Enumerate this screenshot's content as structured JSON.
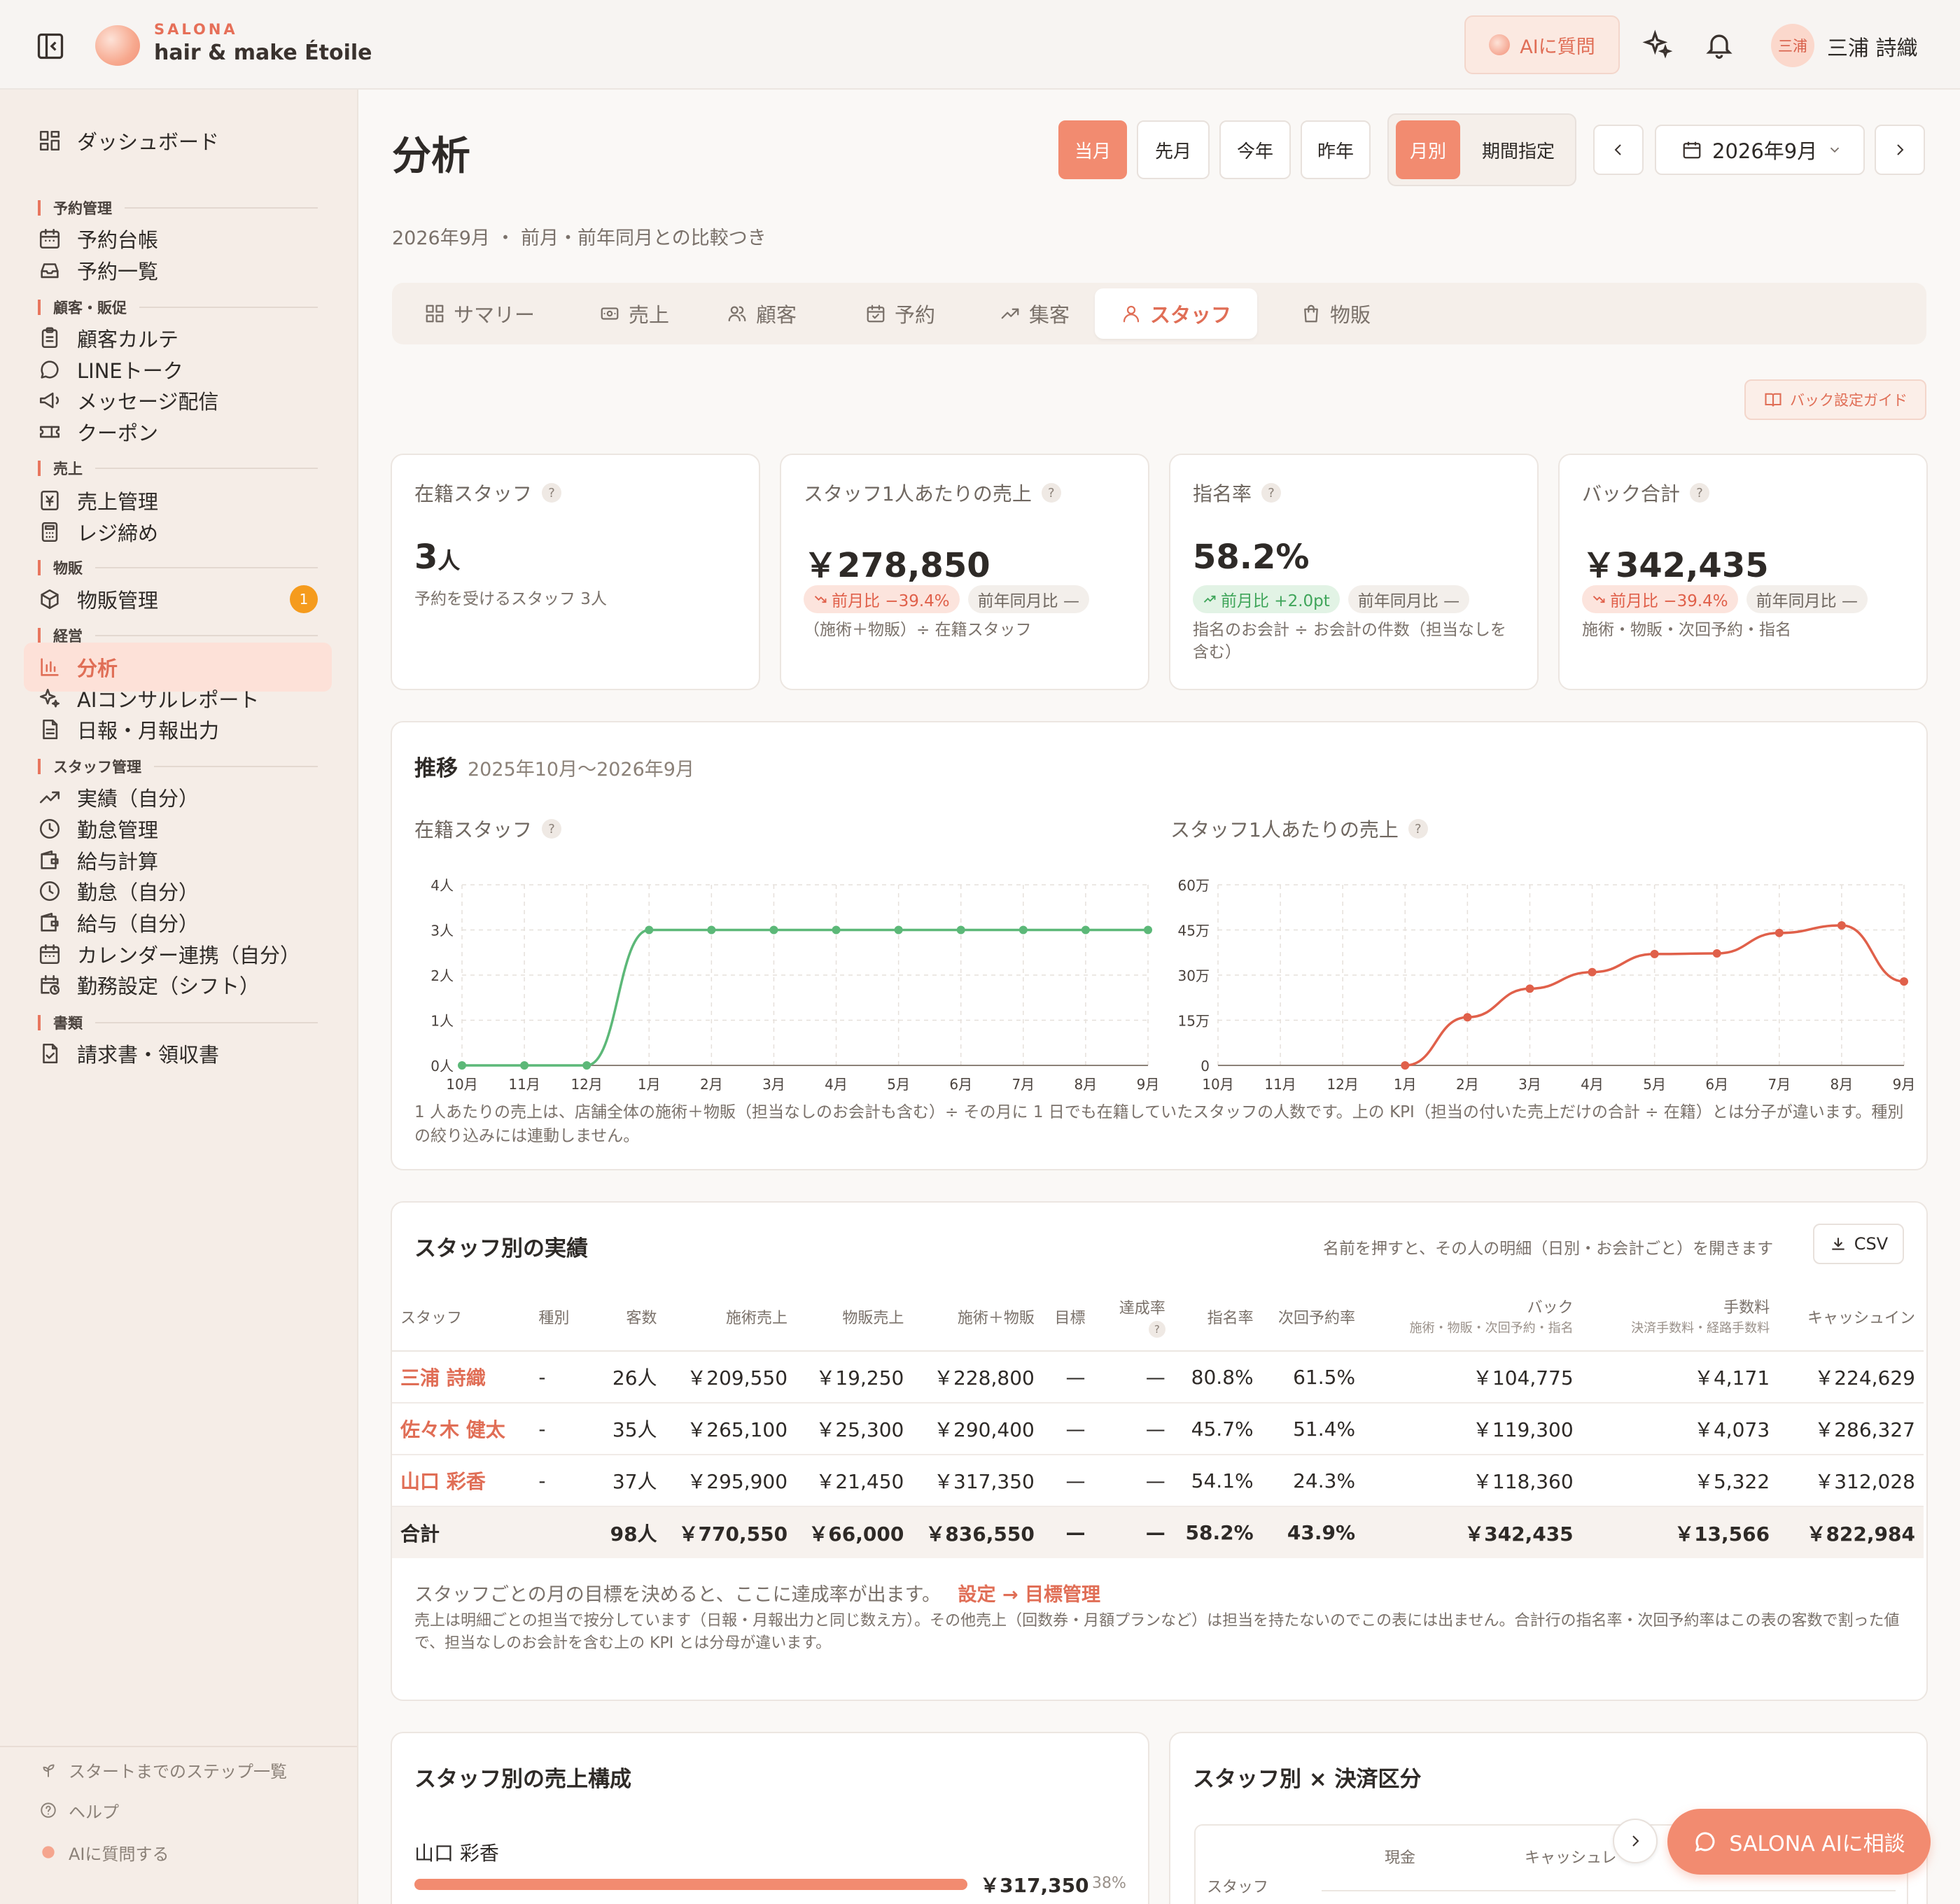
{
  "header": {
    "brand_small": "SALONA",
    "brand_name": "hair & make Étoile",
    "ai_button": "AIに質問",
    "avatar_text": "三浦",
    "user_name": "三浦 詩織"
  },
  "sidebar": {
    "items": [
      {
        "type": "item",
        "label": "ダッシュボード",
        "icon": "dashboard-icon"
      },
      {
        "type": "section",
        "label": "予約管理"
      },
      {
        "type": "item",
        "label": "予約台帳",
        "icon": "calendar-icon"
      },
      {
        "type": "item",
        "label": "予約一覧",
        "icon": "inbox-icon"
      },
      {
        "type": "section",
        "label": "顧客・販促"
      },
      {
        "type": "item",
        "label": "顧客カルテ",
        "icon": "clipboard-icon"
      },
      {
        "type": "item",
        "label": "LINEトーク",
        "icon": "chat-icon"
      },
      {
        "type": "item",
        "label": "メッセージ配信",
        "icon": "megaphone-icon"
      },
      {
        "type": "item",
        "label": "クーポン",
        "icon": "ticket-icon"
      },
      {
        "type": "section",
        "label": "売上"
      },
      {
        "type": "item",
        "label": "売上管理",
        "icon": "yen-receipt-icon"
      },
      {
        "type": "item",
        "label": "レジ締め",
        "icon": "calculator-icon"
      },
      {
        "type": "section",
        "label": "物販"
      },
      {
        "type": "item",
        "label": "物販管理",
        "icon": "box-icon",
        "badge": "1"
      },
      {
        "type": "section",
        "label": "経営"
      },
      {
        "type": "item",
        "label": "分析",
        "icon": "bar-chart-icon",
        "active": true
      },
      {
        "type": "item",
        "label": "AIコンサルレポート",
        "icon": "sparkles-icon"
      },
      {
        "type": "item",
        "label": "日報・月報出力",
        "icon": "document-icon"
      },
      {
        "type": "section",
        "label": "スタッフ管理"
      },
      {
        "type": "item",
        "label": "実績（自分）",
        "icon": "trending-up-icon"
      },
      {
        "type": "item",
        "label": "勤怠管理",
        "icon": "clock-icon"
      },
      {
        "type": "item",
        "label": "給与計算",
        "icon": "wallet-icon"
      },
      {
        "type": "item",
        "label": "勤怠（自分）",
        "icon": "clock-icon"
      },
      {
        "type": "item",
        "label": "給与（自分）",
        "icon": "wallet-icon"
      },
      {
        "type": "item",
        "label": "カレンダー連携（自分）",
        "icon": "calendar-icon"
      },
      {
        "type": "item",
        "label": "勤務設定（シフト）",
        "icon": "calendar-clock-icon"
      },
      {
        "type": "section",
        "label": "書類"
      },
      {
        "type": "item",
        "label": "請求書・領収書",
        "icon": "document-check-icon"
      }
    ],
    "footer": [
      {
        "label": "スタートまでのステップ一覧",
        "icon": "sprout-icon"
      },
      {
        "label": "ヘルプ",
        "icon": "help-icon"
      },
      {
        "label": "AIに質問する",
        "icon": "ai-dot-icon"
      }
    ]
  },
  "page": {
    "title": "分析",
    "subtitle": "2026年9月 ・ 前月・前年同月との比較つき",
    "period_buttons": [
      "当月",
      "先月",
      "今年",
      "昨年"
    ],
    "active_period": "当月",
    "view_modes": [
      "月別",
      "期間指定"
    ],
    "active_view": "月別",
    "current_month": "2026年9月",
    "guide_button": "バック設定ガイド"
  },
  "tabs": [
    {
      "label": "サマリー",
      "icon": "grid-icon"
    },
    {
      "label": "売上",
      "icon": "cash-icon"
    },
    {
      "label": "顧客",
      "icon": "users-icon"
    },
    {
      "label": "予約",
      "icon": "calendar-check-icon"
    },
    {
      "label": "集客",
      "icon": "trending-up-icon"
    },
    {
      "label": "スタッフ",
      "icon": "user-icon",
      "active": true
    },
    {
      "label": "物販",
      "icon": "shopping-bag-icon"
    }
  ],
  "kpis": [
    {
      "label": "在籍スタッフ",
      "value": "3",
      "unit": "人",
      "note": "予約を受けるスタッフ 3人",
      "pills": []
    },
    {
      "label": "スタッフ1人あたりの売上",
      "value": "￥278,850",
      "unit": "",
      "note": "（施術＋物販）÷ 在籍スタッフ",
      "pills": [
        {
          "text": "前月比 −39.4%",
          "kind": "down"
        },
        {
          "text": "前年同月比 —",
          "kind": "neutral"
        }
      ]
    },
    {
      "label": "指名率",
      "value": "58.2%",
      "unit": "",
      "note": "指名のお会計 ÷ お会計の件数（担当なしを含む）",
      "pills": [
        {
          "text": "前月比 +2.0pt",
          "kind": "up"
        },
        {
          "text": "前年同月比 —",
          "kind": "neutral"
        }
      ]
    },
    {
      "label": "バック合計",
      "value": "￥342,435",
      "unit": "",
      "note": "施術・物販・次回予約・指名",
      "pills": [
        {
          "text": "前月比 −39.4%",
          "kind": "down"
        },
        {
          "text": "前年同月比 —",
          "kind": "neutral"
        }
      ]
    }
  ],
  "trend": {
    "title": "推移",
    "range": "2025年10月〜2026年9月",
    "note": "1 人あたりの売上は、店舗全体の施術＋物販（担当なしのお会計も含む）÷ その月に 1 日でも在籍していたスタッフの人数です。上の KPI（担当の付いた売上だけの合計 ÷ 在籍）とは分子が違います。種別の絞り込みには連動しません。"
  },
  "chart_data": [
    {
      "type": "line",
      "title": "在籍スタッフ",
      "categories": [
        "10月",
        "11月",
        "12月",
        "1月",
        "2月",
        "3月",
        "4月",
        "5月",
        "6月",
        "7月",
        "8月",
        "9月"
      ],
      "values": [
        0,
        0,
        0,
        3,
        3,
        3,
        3,
        3,
        3,
        3,
        3,
        3
      ],
      "y_ticks": [
        "0人",
        "1人",
        "2人",
        "3人",
        "4人"
      ],
      "ylim": [
        0,
        4
      ],
      "color": "#5cb878",
      "grid": true
    },
    {
      "type": "line",
      "title": "スタッフ1人あたりの売上",
      "categories": [
        "10月",
        "11月",
        "12月",
        "1月",
        "2月",
        "3月",
        "4月",
        "5月",
        "6月",
        "7月",
        "8月",
        "9月"
      ],
      "values": [
        null,
        null,
        null,
        0,
        160000,
        255000,
        310000,
        370000,
        372000,
        440000,
        465000,
        278850
      ],
      "y_ticks": [
        "0",
        "15万",
        "30万",
        "45万",
        "60万"
      ],
      "ylim": [
        0,
        600000
      ],
      "color": "#e0604a",
      "grid": true
    }
  ],
  "staff_table": {
    "title": "スタッフ別の実績",
    "hint": "名前を押すと、その人の明細（日別・お会計ごと）を開きます",
    "csv_label": "CSV",
    "headers": [
      {
        "label": "スタッフ",
        "sub": ""
      },
      {
        "label": "種別",
        "sub": ""
      },
      {
        "label": "客数",
        "sub": ""
      },
      {
        "label": "施術売上",
        "sub": ""
      },
      {
        "label": "物販売上",
        "sub": ""
      },
      {
        "label": "施術＋物販",
        "sub": ""
      },
      {
        "label": "目標",
        "sub": ""
      },
      {
        "label": "達成率",
        "sub": ""
      },
      {
        "label": "指名率",
        "sub": ""
      },
      {
        "label": "次回予約率",
        "sub": ""
      },
      {
        "label": "バック",
        "sub": "施術・物販・次回予約・指名"
      },
      {
        "label": "手数料",
        "sub": "決済手数料・経路手数料"
      },
      {
        "label": "キャッシュイン",
        "sub": ""
      }
    ],
    "rows": [
      [
        "三浦 詩織",
        "-",
        "26人",
        "￥209,550",
        "￥19,250",
        "￥228,800",
        "—",
        "—",
        "80.8%",
        "61.5%",
        "￥104,775",
        "￥4,171",
        "￥224,629"
      ],
      [
        "佐々木 健太",
        "-",
        "35人",
        "￥265,100",
        "￥25,300",
        "￥290,400",
        "—",
        "—",
        "45.7%",
        "51.4%",
        "￥119,300",
        "￥4,073",
        "￥286,327"
      ],
      [
        "山口 彩香",
        "-",
        "37人",
        "￥295,900",
        "￥21,450",
        "￥317,350",
        "—",
        "—",
        "54.1%",
        "24.3%",
        "￥118,360",
        "￥5,322",
        "￥312,028"
      ]
    ],
    "total": [
      "合計",
      "",
      "98人",
      "￥770,550",
      "￥66,000",
      "￥836,550",
      "—",
      "—",
      "58.2%",
      "43.9%",
      "￥342,435",
      "￥13,566",
      "￥822,984"
    ],
    "goal_note": "スタッフごとの月の目標を決めると、ここに達成率が出ます。",
    "goal_link": "設定 → 目標管理",
    "footnote": "売上は明細ごとの担当で按分しています（日報・月報出力と同じ数え方）。その他売上（回数券・月額プランなど）は担当を持たないのでこの表には出ません。合計行の指名率・次回予約率はこの表の客数で割った値で、担当なしのお会計を含む上の KPI とは分母が違います。"
  },
  "composition": {
    "title": "スタッフ別の売上構成",
    "staff": "山口 彩香",
    "amount": "￥317,350",
    "share": "38%",
    "share_fraction": 0.38
  },
  "payment": {
    "title": "スタッフ別 × 決済区分",
    "col_staff": "スタッフ",
    "col_cash": "現金",
    "col_cashless": "キャッシュレ"
  },
  "fab": {
    "label": "SALONA AIに相談"
  },
  "colors": {
    "accent": "#f28b70",
    "accent_text": "#e06e56",
    "green": "#5cb878",
    "red": "#e0604a"
  }
}
